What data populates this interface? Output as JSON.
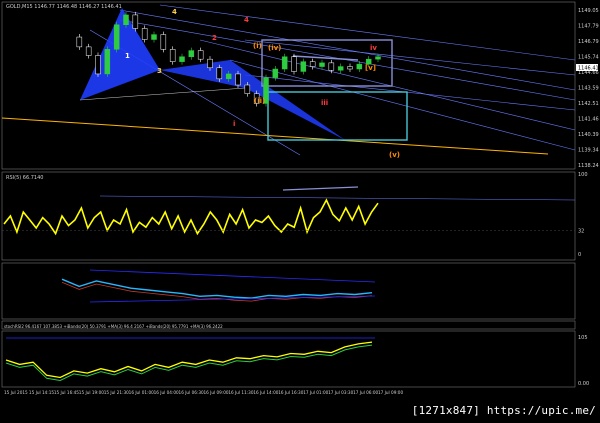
{
  "header": {
    "symbol_line": "GOLD,M15  1146.77  1146.48  1146.27  1146.41"
  },
  "chart_data": [
    {
      "type": "line",
      "panel": "price",
      "ylim": [
        1138.0,
        1150.2
      ],
      "y_ticks": [
        "1149.05",
        "1147.79",
        "1146.79",
        "1145.74",
        "1144.66",
        "1143.59",
        "1142.51",
        "1141.46",
        "1140.39",
        "1139.34",
        "1138.24"
      ],
      "last_price_label": "1146.41",
      "series": [
        {
          "name": "",
          "values": [
            1148.0,
            1147.2,
            1146.5,
            1145.0,
            1147.0,
            1149.0,
            1149.8,
            1148.7,
            1147.8,
            1148.2,
            1147.0,
            1146.0,
            1146.4,
            1146.9,
            1146.2,
            1145.5,
            1144.6,
            1145.0,
            1144.1,
            1143.4,
            1142.6,
            1144.7,
            1145.4,
            1146.4,
            1145.2,
            1146.0,
            1145.6,
            1145.9,
            1145.3,
            1145.6,
            1145.4,
            1145.8,
            1146.2,
            1146.4
          ]
        }
      ],
      "wave_labels": [
        {
          "text": "1",
          "color": "#ffffff"
        },
        {
          "text": "2",
          "color": "#ff3b3b"
        },
        {
          "text": "3",
          "color": "#ffd24a"
        },
        {
          "text": "4",
          "color": "#ffd24a"
        },
        {
          "text": "4",
          "color": "#ff3b3b"
        },
        {
          "text": "i",
          "color": "#ff3b3b"
        },
        {
          "text": "(i)",
          "color": "#ff8a00"
        },
        {
          "text": "(ii)",
          "color": "#ff8a00"
        },
        {
          "text": "iii",
          "color": "#ff3b3b"
        },
        {
          "text": "iv",
          "color": "#ff3b3b"
        },
        {
          "text": "(iv)",
          "color": "#ff8a00"
        },
        {
          "text": "(v)",
          "color": "#ff8a00"
        },
        {
          "text": "[v]",
          "color": "#ff8a00"
        }
      ]
    },
    {
      "type": "line",
      "panel": "rsi",
      "title": "RSI(5) 66.7140",
      "ylim": [
        0,
        100
      ],
      "y_ticks": [
        "100",
        "32",
        "0"
      ],
      "series": [
        {
          "name": "",
          "values": [
            40,
            50,
            30,
            55,
            45,
            35,
            48,
            40,
            28,
            50,
            38,
            45,
            60,
            35,
            48,
            55,
            32,
            45,
            40,
            58,
            30,
            42,
            36,
            48,
            40,
            55,
            34,
            50,
            30,
            45,
            28,
            40,
            55,
            45,
            30,
            52,
            40,
            58,
            35,
            45,
            42,
            50,
            38,
            30,
            40,
            36,
            60,
            30,
            48,
            55,
            70,
            52,
            44,
            60,
            45,
            62,
            40,
            55,
            66
          ]
        }
      ]
    },
    {
      "type": "line",
      "panel": "oscillator",
      "series": [
        {
          "name": "",
          "values": [
            0.6,
            0.2,
            0.5,
            0.3,
            0.1,
            0.0,
            -0.1,
            -0.2,
            -0.35,
            -0.3,
            -0.4,
            -0.45,
            -0.3,
            -0.35,
            -0.25,
            -0.3,
            -0.2,
            -0.25,
            -0.15
          ]
        }
      ]
    },
    {
      "type": "line",
      "panel": "stochrsi",
      "title": "stochRSI2 96.4167  107.3853  +iBands(20) 50.3791  +MA(3) 96.4 2167  +iBands(20) 95.7791  +MA(3) 96.2422",
      "ylim": [
        0,
        110
      ],
      "y_ticks": [
        "105",
        "0.00"
      ],
      "series": [
        {
          "name": "",
          "values": [
            55,
            45,
            50,
            20,
            15,
            30,
            25,
            35,
            28,
            40,
            30,
            45,
            38,
            50,
            45,
            55,
            50,
            60,
            58,
            65,
            62,
            70,
            68,
            75,
            72,
            85,
            92,
            96
          ]
        }
      ]
    }
  ],
  "x_axis": {
    "labels": [
      "15 Jul 2015",
      "15 Jul 14:15",
      "15 Jul 16:45",
      "15 Jul 19:00",
      "15 Jul 21:30",
      "16 Jul 01:00",
      "16 Jul 04:00",
      "16 Jul 06:30",
      "16 Jul 09:00",
      "16 Jul 11:30",
      "16 Jul 14:00",
      "16 Jul 16:30",
      "17 Jul 01:00",
      "17 Jul 03:30",
      "17 Jul 06:00",
      "17 Jul 09:00"
    ]
  },
  "watermark": "[1271x847] https://upic.me/",
  "colors": {
    "background": "#000000",
    "bull_candle": "#2ecc40",
    "channel": "#6a7dff",
    "gold_line": "#ffb400",
    "pattern_fill": "#1f3dff",
    "rsi_line": "#ffff00",
    "box_a": "#8a8fd6",
    "box_b": "#48c6d4"
  }
}
